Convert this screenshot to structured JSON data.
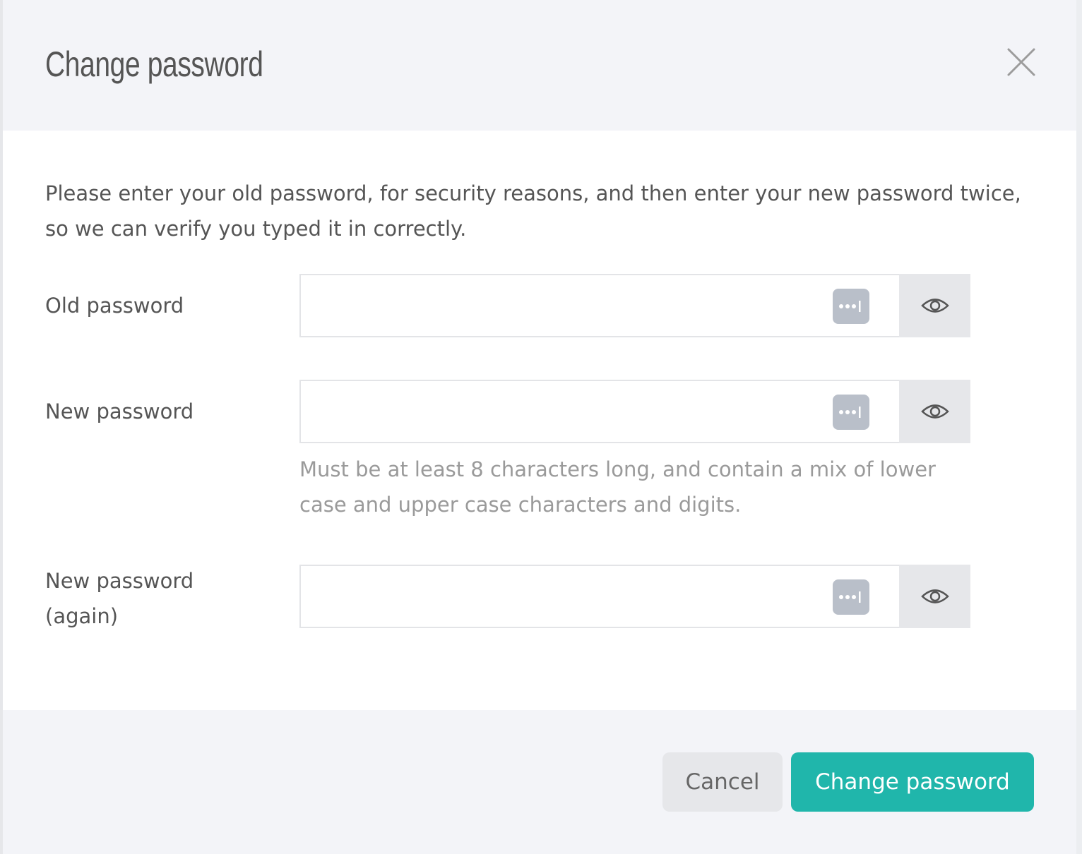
{
  "dialog": {
    "title": "Change password",
    "close_icon": "close-icon",
    "intro_text": "Please enter your old password, for security reasons, and then enter your new password twice, so we can verify you typed it in correctly.",
    "fields": [
      {
        "label": "Old password",
        "value": "",
        "keychain_icon": "password-manager-icon",
        "toggle_icon": "eye-icon"
      },
      {
        "label": "New password",
        "value": "",
        "keychain_icon": "password-manager-icon",
        "toggle_icon": "eye-icon",
        "hint": "Must be at least 8 characters long, and contain a mix of lower case and upper case characters and digits."
      },
      {
        "label": "New password (again)",
        "value": "",
        "keychain_icon": "password-manager-icon",
        "toggle_icon": "eye-icon"
      }
    ],
    "buttons": {
      "cancel_label": "Cancel",
      "submit_label": "Change password"
    },
    "colors": {
      "accent": "#20b6ab",
      "header_bg": "#f3f4f8",
      "body_bg": "#ffffff",
      "cancel_bg": "#e6e7ea"
    }
  }
}
